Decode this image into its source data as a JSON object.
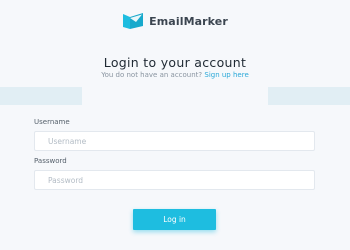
{
  "brand": {
    "name": "EmailMarker",
    "logo_icon": "envelope-logo-icon",
    "accent_color": "#1ebde0"
  },
  "header": {
    "title": "Login to your account",
    "subtitle_text": "You do not have an account?",
    "signup_link": "Sign up here"
  },
  "form": {
    "username": {
      "label": "Username",
      "placeholder": "Username",
      "value": ""
    },
    "password": {
      "label": "Password",
      "placeholder": "Password",
      "value": ""
    },
    "submit_label": "Log in"
  }
}
